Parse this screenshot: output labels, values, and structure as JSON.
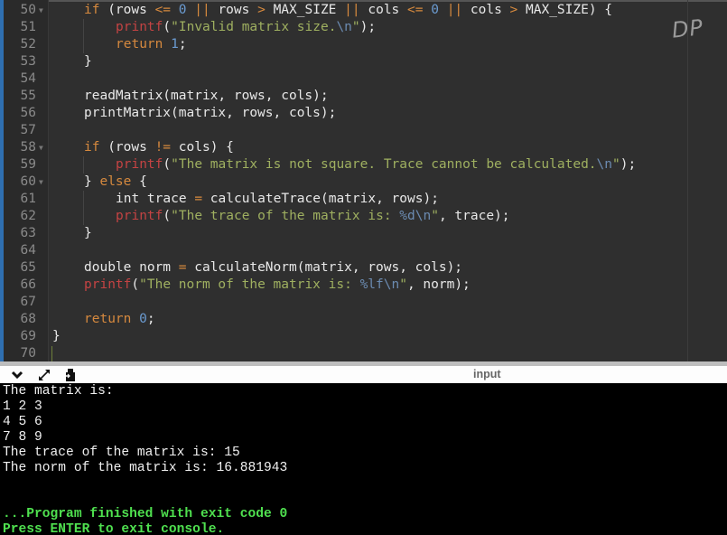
{
  "editor": {
    "watermark": "DP",
    "lines": [
      {
        "num": "50",
        "fold": true,
        "indent": 1,
        "tokens": [
          [
            "kw",
            "if"
          ],
          [
            "pl",
            " (rows "
          ],
          [
            "op",
            "<="
          ],
          [
            "pl",
            " "
          ],
          [
            "num",
            "0"
          ],
          [
            "pl",
            " "
          ],
          [
            "op",
            "||"
          ],
          [
            "pl",
            " rows "
          ],
          [
            "op",
            ">"
          ],
          [
            "pl",
            " MAX_SIZE "
          ],
          [
            "op",
            "||"
          ],
          [
            "pl",
            " cols "
          ],
          [
            "op",
            "<="
          ],
          [
            "pl",
            " "
          ],
          [
            "num",
            "0"
          ],
          [
            "pl",
            " "
          ],
          [
            "op",
            "||"
          ],
          [
            "pl",
            " cols "
          ],
          [
            "op",
            ">"
          ],
          [
            "pl",
            " MAX_SIZE) {"
          ]
        ]
      },
      {
        "num": "51",
        "fold": false,
        "indent": 2,
        "tokens": [
          [
            "fn",
            "printf"
          ],
          [
            "pl",
            "("
          ],
          [
            "str",
            "\"Invalid matrix size."
          ],
          [
            "esc",
            "\\n"
          ],
          [
            "str",
            "\""
          ],
          [
            "pl",
            ");"
          ]
        ]
      },
      {
        "num": "52",
        "fold": false,
        "indent": 2,
        "tokens": [
          [
            "kw",
            "return"
          ],
          [
            "pl",
            " "
          ],
          [
            "num",
            "1"
          ],
          [
            "pl",
            ";"
          ]
        ]
      },
      {
        "num": "53",
        "fold": false,
        "indent": 1,
        "tokens": [
          [
            "pl",
            "}"
          ]
        ]
      },
      {
        "num": "54",
        "fold": false,
        "indent": 0,
        "tokens": []
      },
      {
        "num": "55",
        "fold": false,
        "indent": 1,
        "tokens": [
          [
            "pl",
            "readMatrix(matrix, rows, cols);"
          ]
        ]
      },
      {
        "num": "56",
        "fold": false,
        "indent": 1,
        "tokens": [
          [
            "pl",
            "printMatrix(matrix, rows, cols);"
          ]
        ]
      },
      {
        "num": "57",
        "fold": false,
        "indent": 0,
        "tokens": []
      },
      {
        "num": "58",
        "fold": true,
        "indent": 1,
        "tokens": [
          [
            "kw",
            "if"
          ],
          [
            "pl",
            " (rows "
          ],
          [
            "op",
            "!="
          ],
          [
            "pl",
            " cols) {"
          ]
        ]
      },
      {
        "num": "59",
        "fold": false,
        "indent": 2,
        "tokens": [
          [
            "fn",
            "printf"
          ],
          [
            "pl",
            "("
          ],
          [
            "str",
            "\"The matrix is not square. Trace cannot be calculated."
          ],
          [
            "esc",
            "\\n"
          ],
          [
            "str",
            "\""
          ],
          [
            "pl",
            ");"
          ]
        ]
      },
      {
        "num": "60",
        "fold": true,
        "indent": 1,
        "tokens": [
          [
            "pl",
            "} "
          ],
          [
            "kw",
            "else"
          ],
          [
            "pl",
            " {"
          ]
        ]
      },
      {
        "num": "61",
        "fold": false,
        "indent": 2,
        "tokens": [
          [
            "pl",
            "int trace "
          ],
          [
            "op",
            "="
          ],
          [
            "pl",
            " calculateTrace(matrix, rows);"
          ]
        ]
      },
      {
        "num": "62",
        "fold": false,
        "indent": 2,
        "tokens": [
          [
            "fn",
            "printf"
          ],
          [
            "pl",
            "("
          ],
          [
            "str",
            "\"The trace of the matrix is: "
          ],
          [
            "esc",
            "%d\\n"
          ],
          [
            "str",
            "\""
          ],
          [
            "pl",
            ", trace);"
          ]
        ]
      },
      {
        "num": "63",
        "fold": false,
        "indent": 1,
        "tokens": [
          [
            "pl",
            "}"
          ]
        ]
      },
      {
        "num": "64",
        "fold": false,
        "indent": 0,
        "tokens": []
      },
      {
        "num": "65",
        "fold": false,
        "indent": 1,
        "tokens": [
          [
            "pl",
            "double norm "
          ],
          [
            "op",
            "="
          ],
          [
            "pl",
            " calculateNorm(matrix, rows, cols);"
          ]
        ]
      },
      {
        "num": "66",
        "fold": false,
        "indent": 1,
        "tokens": [
          [
            "fn",
            "printf"
          ],
          [
            "pl",
            "("
          ],
          [
            "str",
            "\"The norm of the matrix is: "
          ],
          [
            "esc",
            "%lf\\n"
          ],
          [
            "str",
            "\""
          ],
          [
            "pl",
            ", norm);"
          ]
        ]
      },
      {
        "num": "67",
        "fold": false,
        "indent": 0,
        "tokens": []
      },
      {
        "num": "68",
        "fold": false,
        "indent": 1,
        "tokens": [
          [
            "kw",
            "return"
          ],
          [
            "pl",
            " "
          ],
          [
            "num",
            "0"
          ],
          [
            "pl",
            ";"
          ]
        ]
      },
      {
        "num": "69",
        "fold": false,
        "indent": 0,
        "tokens": [
          [
            "pl",
            "}"
          ]
        ]
      },
      {
        "num": "70",
        "fold": false,
        "indent": 0,
        "tokens": []
      }
    ]
  },
  "console": {
    "title": "input",
    "buttons": [
      {
        "name": "collapse-console-button",
        "icon": "chevron-down-icon"
      },
      {
        "name": "maximize-console-button",
        "icon": "expand-arrows-icon"
      },
      {
        "name": "copy-output-button",
        "icon": "clipboard-icon"
      }
    ],
    "output": [
      {
        "text": "The matrix is:",
        "style": "normal"
      },
      {
        "text": "1 2 3",
        "style": "normal"
      },
      {
        "text": "4 5 6",
        "style": "normal"
      },
      {
        "text": "7 8 9",
        "style": "normal"
      },
      {
        "text": "The trace of the matrix is: 15",
        "style": "normal"
      },
      {
        "text": "The norm of the matrix is: 16.881943",
        "style": "normal"
      },
      {
        "text": "",
        "style": "normal"
      },
      {
        "text": "",
        "style": "normal"
      },
      {
        "text": "...Program finished with exit code 0",
        "style": "green"
      },
      {
        "text": "Press ENTER to exit console.",
        "style": "green"
      }
    ]
  }
}
